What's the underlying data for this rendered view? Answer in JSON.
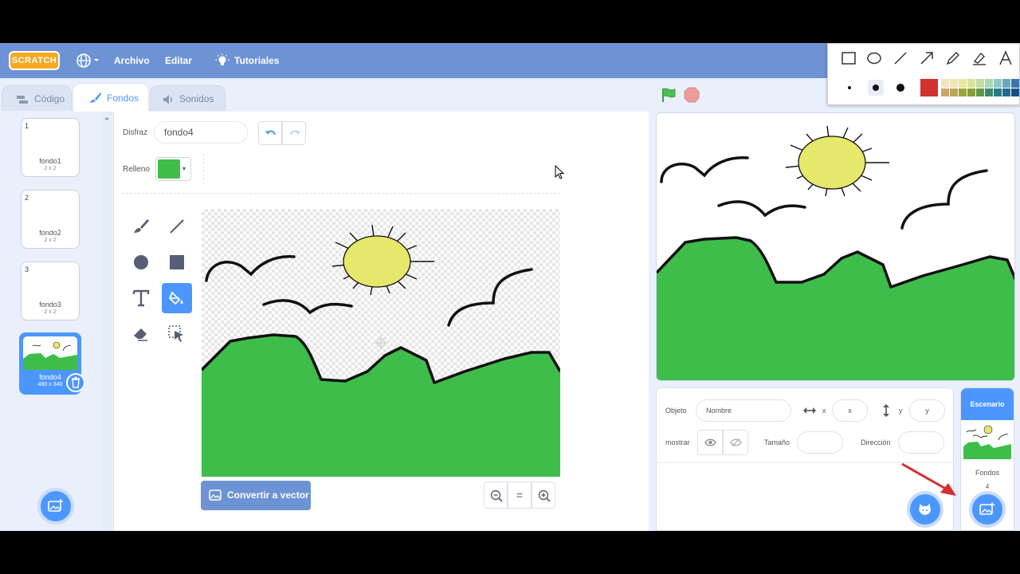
{
  "menubar": {
    "logo": "SCRATCH",
    "file": "Archivo",
    "edit": "Editar",
    "tutorials": "Tutoriales"
  },
  "tabs": [
    {
      "label": "Código",
      "icon": "code-icon"
    },
    {
      "label": "Fondos",
      "icon": "brush-icon",
      "active": true
    },
    {
      "label": "Sonidos",
      "icon": "speaker-icon"
    }
  ],
  "costumes": [
    {
      "num": "1",
      "name": "fondo1",
      "size": "2 x 2"
    },
    {
      "num": "2",
      "name": "fondo2",
      "size": "2 x 2"
    },
    {
      "num": "3",
      "name": "fondo3",
      "size": "2 x 2"
    },
    {
      "num": "4",
      "name": "fondo4",
      "size": "480 x 340",
      "selected": true
    }
  ],
  "editor": {
    "costume_label": "Disfraz",
    "costume_name": "fondo4",
    "fill_label": "Relleno",
    "fill_color": "#3fbd4b",
    "convert_button": "Convertir a vector",
    "zoom_reset": "="
  },
  "sprite_info": {
    "object_label": "Objeto",
    "name_placeholder": "Nombre",
    "x_label": "x",
    "x_placeholder": "x",
    "y_label": "y",
    "y_placeholder": "y",
    "show_label": "mostrar",
    "size_label": "Tamaño",
    "direction_label": "Dirección"
  },
  "stage_panel": {
    "title": "Escenario",
    "backdrops_label": "Fondos",
    "backdrops_count": "4"
  },
  "colors": {
    "accent": "#4c97ff",
    "menubar": "#6d93d5",
    "ground_green": "#3fbd4b",
    "sun_yellow": "#e6e86c",
    "arrow_red": "#d33030"
  }
}
